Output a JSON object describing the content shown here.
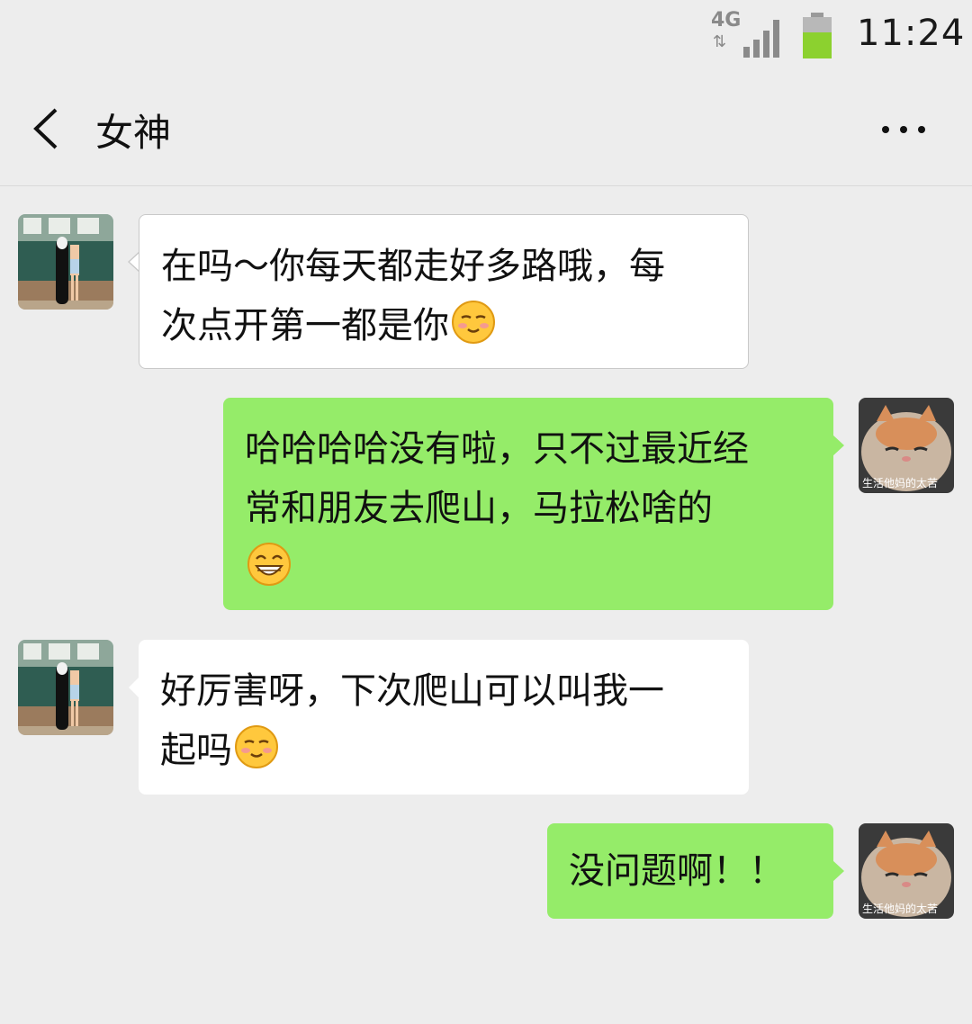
{
  "status": {
    "network": "4G",
    "time": "11:24"
  },
  "chat": {
    "title": "女神"
  },
  "avatar_caption": "生活他妈的太苦",
  "messages": [
    {
      "from": "them",
      "lines": [
        "在吗～你每天都走好多路哦，每",
        "次点开第一都是你"
      ],
      "emoji": "blush-smile"
    },
    {
      "from": "me",
      "lines": [
        "哈哈哈哈没有啦，只不过最近经",
        "常和朋友去爬山，马拉松啥的"
      ],
      "emoji": "grin"
    },
    {
      "from": "them",
      "lines": [
        "好厉害呀，下次爬山可以叫我一",
        "起吗"
      ],
      "emoji": "blush-smile"
    },
    {
      "from": "me",
      "lines": [
        "没问题啊！！"
      ],
      "emoji": ""
    }
  ],
  "colors": {
    "background": "#EDEDED",
    "incoming_bubble": "#FFFFFF",
    "outgoing_bubble": "#95EC69",
    "battery": "#8CD12F"
  }
}
